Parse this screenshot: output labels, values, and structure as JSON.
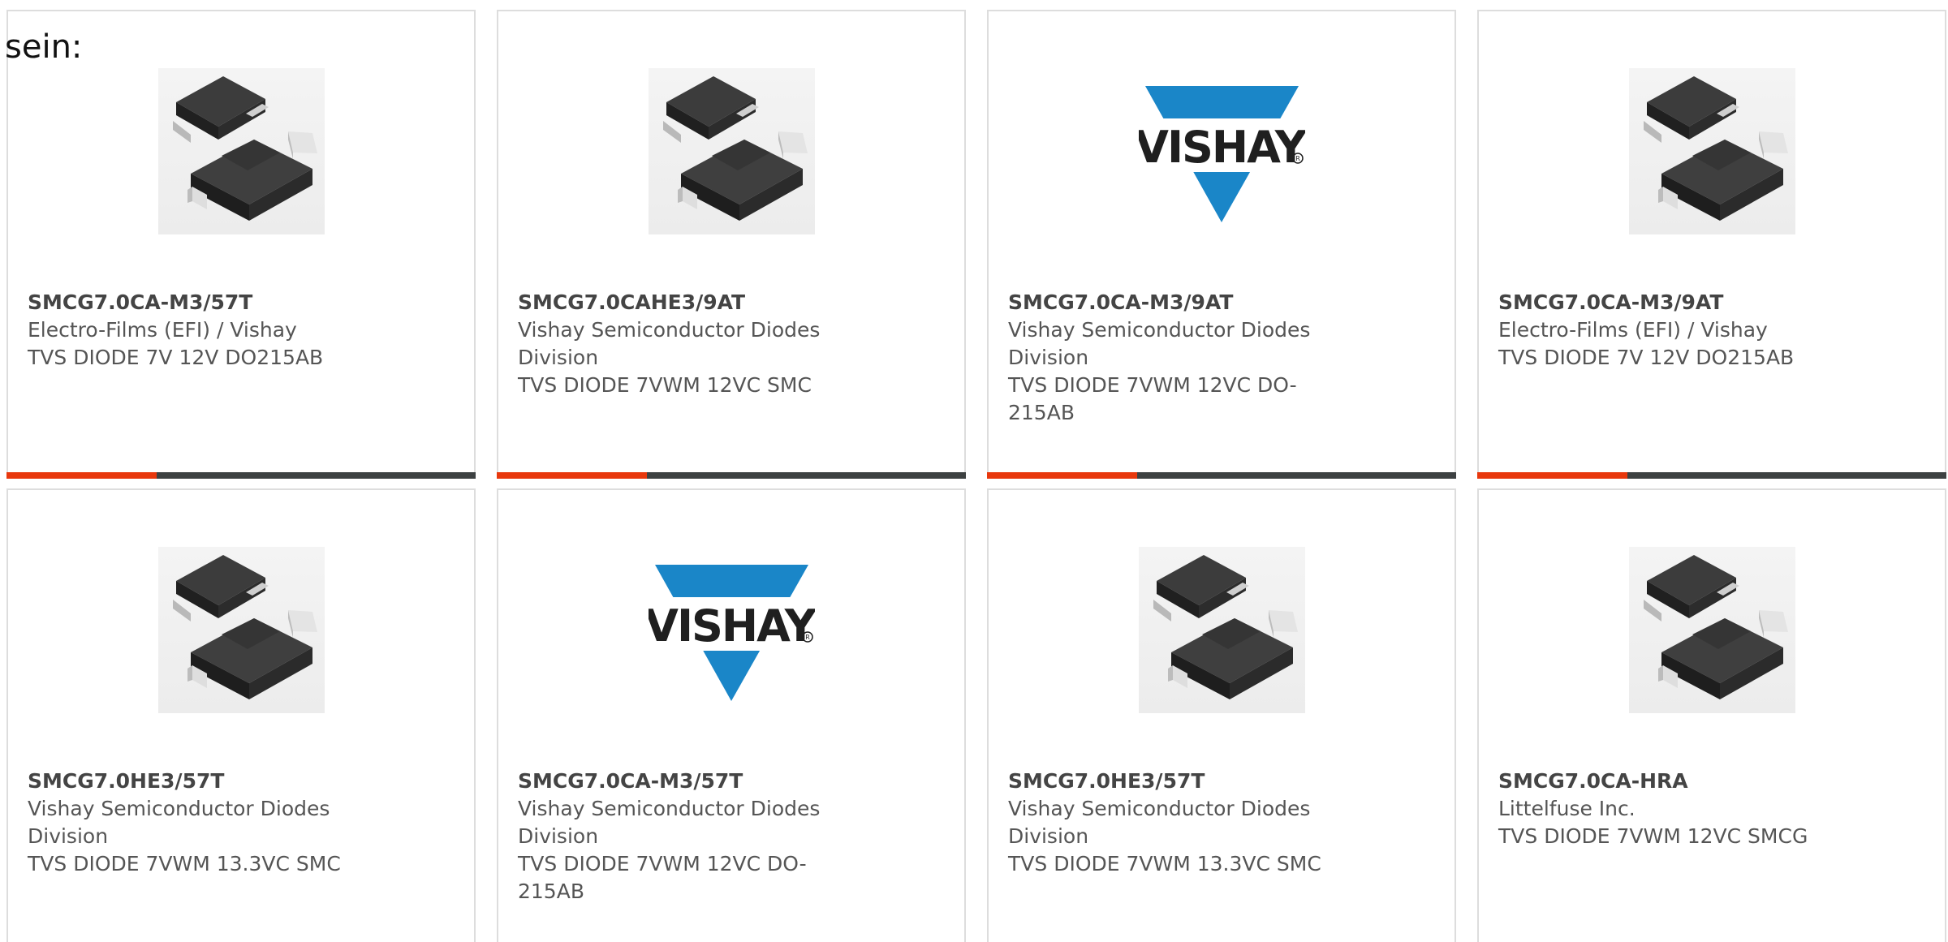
{
  "lead_text": "sein:",
  "colors": {
    "accent": "#e8380d",
    "track": "#3d4142",
    "border": "#dddddd",
    "vishay_blue": "#1a86c8",
    "text": "#555555"
  },
  "cards": [
    {
      "part_number": "SMCG7.0CA-M3/57T",
      "manufacturer": "Electro-Films (EFI) / Vishay",
      "description": "TVS DIODE 7V 12V DO215AB",
      "image_icon": "diode-package-icon",
      "progress": 0.32
    },
    {
      "part_number": "SMCG7.0CAHE3/9AT",
      "manufacturer": "Vishay Semiconductor Diodes Division",
      "description": "TVS DIODE 7VWM 12VC SMC",
      "image_icon": "diode-package-icon",
      "progress": 0.32
    },
    {
      "part_number": "SMCG7.0CA-M3/9AT",
      "manufacturer": "Vishay Semiconductor Diodes Division",
      "description": "TVS DIODE 7VWM 12VC DO-215AB",
      "image_icon": "vishay-logo",
      "logo_text": "VISHAY",
      "progress": 0.32
    },
    {
      "part_number": "SMCG7.0CA-M3/9AT",
      "manufacturer": "Electro-Films (EFI) / Vishay",
      "description": "TVS DIODE 7V 12V DO215AB",
      "image_icon": "diode-package-icon",
      "progress": 0.32
    },
    {
      "part_number": "SMCG7.0HE3/57T",
      "manufacturer": "Vishay Semiconductor Diodes Division",
      "description": "TVS DIODE 7VWM 13.3VC SMC",
      "image_icon": "diode-package-icon"
    },
    {
      "part_number": "SMCG7.0CA-M3/57T",
      "manufacturer": "Vishay Semiconductor Diodes Division",
      "description": "TVS DIODE 7VWM 12VC DO-215AB",
      "image_icon": "vishay-logo",
      "logo_text": "VISHAY"
    },
    {
      "part_number": "SMCG7.0HE3/57T",
      "manufacturer": "Vishay Semiconductor Diodes Division",
      "description": "TVS DIODE 7VWM 13.3VC SMC",
      "image_icon": "diode-package-icon"
    },
    {
      "part_number": "SMCG7.0CA-HRA",
      "manufacturer": "Littelfuse Inc.",
      "description": "TVS DIODE 7VWM 12VC SMCG",
      "image_icon": "diode-package-icon"
    }
  ]
}
